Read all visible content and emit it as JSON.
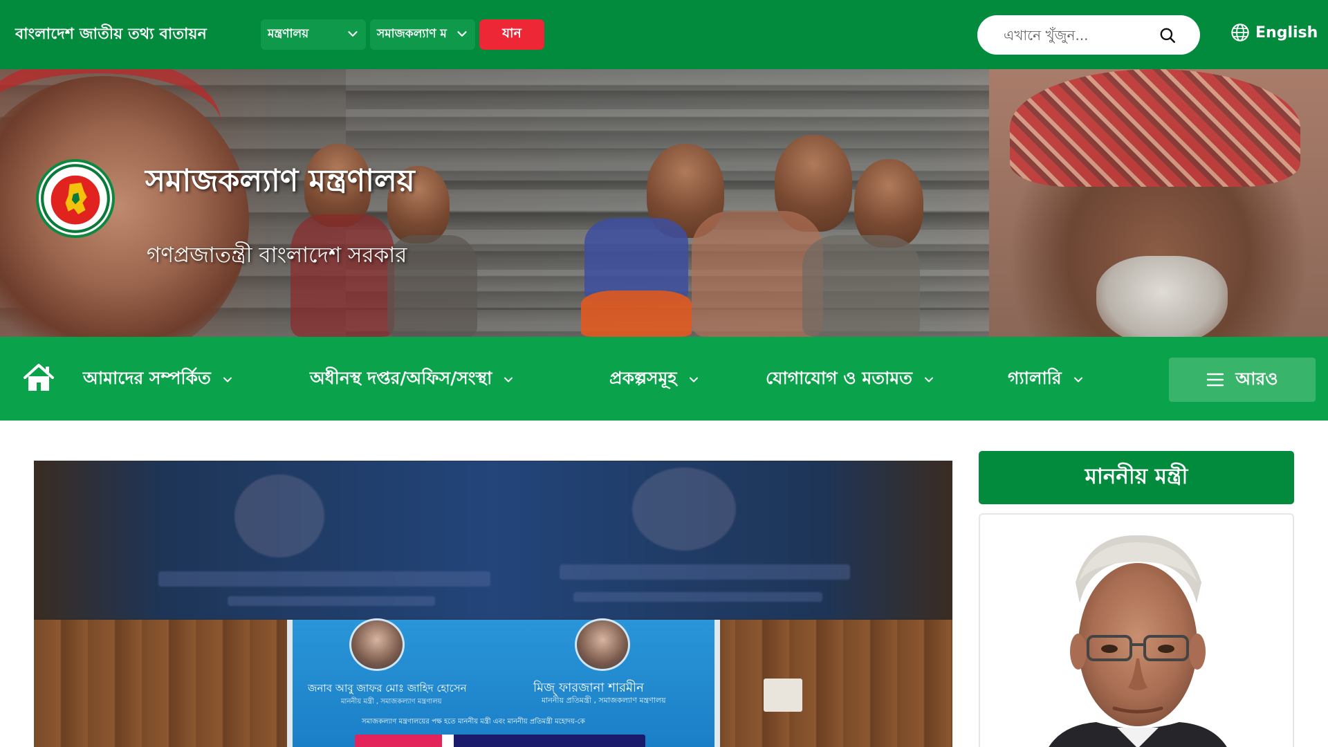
{
  "topbar": {
    "portal_title": "বাংলাদেশ জাতীয় তথ্য বাতায়ন",
    "select_ministry": "মন্ত্রণালয়",
    "select_office": "সমাজকল্যাণ ম",
    "go_button": "যান",
    "search_placeholder": "এখানে খুঁজুন...",
    "language": "English"
  },
  "banner": {
    "title": "সমাজকল্যাণ মন্ত্রণালয়",
    "subtitle": "গণপ্রজাতন্ত্রী বাংলাদেশ সরকার"
  },
  "nav": {
    "items": [
      {
        "label": "আমাদের সম্পর্কিত"
      },
      {
        "label": "অধীনস্থ দপ্তর/অফিস/সংস্থা"
      },
      {
        "label": "প্রকল্পসমূহ"
      },
      {
        "label": "যোগাযোগ ও মতামত"
      },
      {
        "label": "গ্যালারি"
      }
    ],
    "more": "আরও"
  },
  "slider": {
    "poster_left_name": "জনাব আবু জাফর মোঃ জাহিদ হোসেন",
    "poster_left_role": "মাননীয় মন্ত্রী , সমাজকল্যাণ মন্ত্রণালয়",
    "poster_right_name": "মিজ্ ফারজানা শারমীন",
    "poster_right_role": "মাননীয় প্রতিমন্ত্রী , সমাজকল্যাণ মন্ত্রণালয়",
    "poster_line": "সমাজকল্যাণ মন্ত্রণালয়ের পক্ষ হতে মাননীয় মন্ত্রী এবং মাননীয় প্রতিমন্ত্রী মহোদয়-কে"
  },
  "sidebar": {
    "minister_heading": "মাননীয় মন্ত্রী"
  },
  "colors": {
    "topbar": "#028a3d",
    "nav": "#0aa24a",
    "go_button": "#ee2737",
    "more_button": "#39b56b"
  },
  "icons": [
    "chevron-down-icon",
    "search-icon",
    "globe-icon",
    "home-icon",
    "menu-icon",
    "government-emblem"
  ]
}
